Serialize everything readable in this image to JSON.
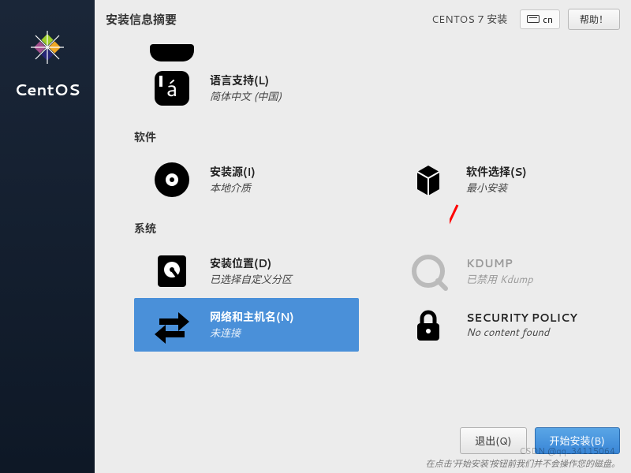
{
  "sidebar": {
    "brand": "CentOS"
  },
  "topbar": {
    "title": "安装信息摘要",
    "product": "CENTOS 7 安装",
    "keyboard": "cn",
    "help": "帮助！"
  },
  "categories": {
    "local": {
      "language": {
        "title": "语言支持(L)",
        "status": "简体中文 (中国)"
      }
    },
    "software": {
      "label": "软件",
      "source": {
        "title": "安装源(I)",
        "status": "本地介质"
      },
      "selection": {
        "title": "软件选择(S)",
        "status": "最小安装"
      }
    },
    "system": {
      "label": "系统",
      "dest": {
        "title": "安装位置(D)",
        "status": "已选择自定义分区"
      },
      "kdump": {
        "title": "KDUMP",
        "status": "已禁用 Kdump"
      },
      "network": {
        "title": "网络和主机名(N)",
        "status": "未连接"
      },
      "security": {
        "title": "SECURITY POLICY",
        "status": "No content found"
      }
    }
  },
  "footer": {
    "quit": "退出(Q)",
    "begin": "开始安装(B)",
    "hint": "在点击'开始安装'按钮前我们并不会操作您的磁盘。"
  },
  "watermark": "CSDN @qq_34115064"
}
